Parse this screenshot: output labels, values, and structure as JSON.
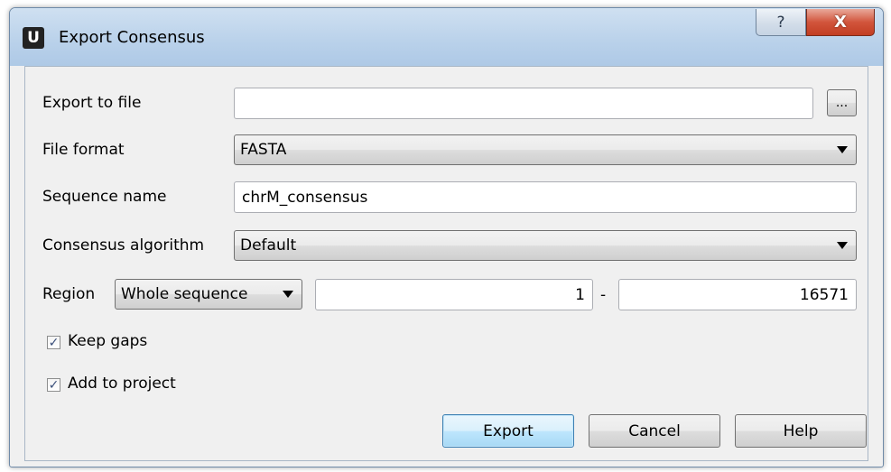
{
  "window": {
    "title": "Export Consensus",
    "app_icon_letter": "U",
    "help_glyph": "?",
    "close_glyph": "X"
  },
  "form": {
    "export_to_file": {
      "label": "Export to file",
      "value": "",
      "browse_label": "..."
    },
    "file_format": {
      "label": "File format",
      "selected": "FASTA"
    },
    "sequence_name": {
      "label": "Sequence name",
      "value": "chrM_consensus"
    },
    "consensus_algorithm": {
      "label": "Consensus algorithm",
      "selected": "Default"
    },
    "region": {
      "label": "Region",
      "selected": "Whole sequence",
      "start": "1",
      "separator": "-",
      "end": "16571"
    },
    "keep_gaps": {
      "label": "Keep gaps",
      "checked": true,
      "mark": "✓"
    },
    "add_to_project": {
      "label": "Add to project",
      "checked": true,
      "mark": "✓"
    }
  },
  "buttons": {
    "export": "Export",
    "cancel": "Cancel",
    "help": "Help"
  },
  "colors": {
    "title_bar": "#b9d1ea",
    "close_button": "#c23d22",
    "dialog_bg": "#f0f0f0",
    "default_button": "#bee6fd"
  }
}
